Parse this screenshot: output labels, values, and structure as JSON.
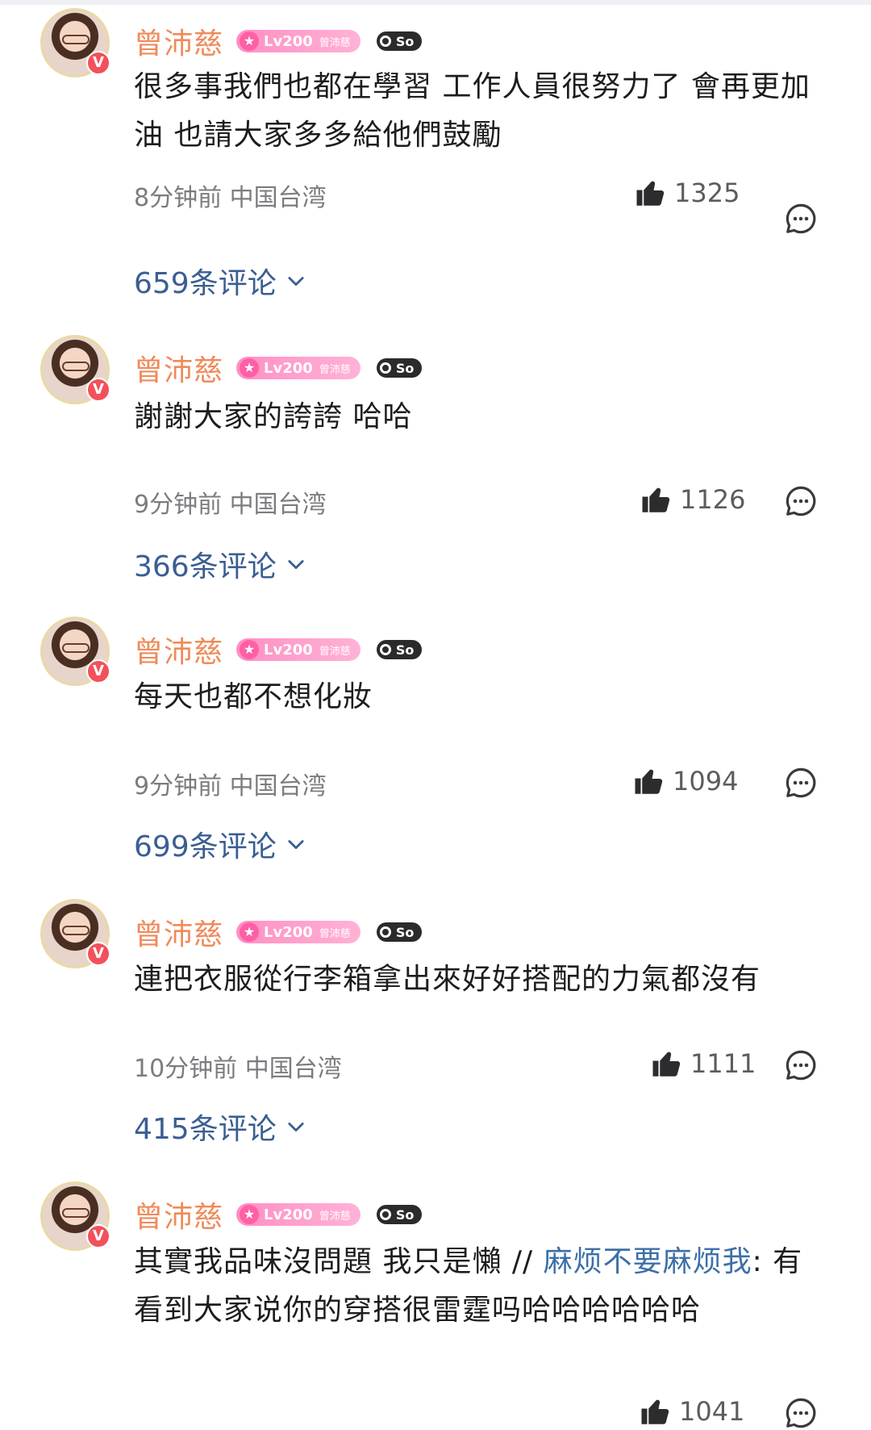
{
  "comments": [
    {
      "username": "曾沛慈",
      "level": "Lv200",
      "level_name": "曾沛慈",
      "so_badge": "So",
      "text": "很多事我們也都在學習 工作人員很努力了 會再更加油 也請大家多多給他們鼓勵",
      "time": "8分钟前",
      "location": "中国台湾",
      "likes": "1325",
      "replies": "659条评论"
    },
    {
      "username": "曾沛慈",
      "level": "Lv200",
      "level_name": "曾沛慈",
      "so_badge": "So",
      "text": "謝謝大家的誇誇 哈哈",
      "time": "9分钟前",
      "location": "中国台湾",
      "likes": "1126",
      "replies": "366条评论"
    },
    {
      "username": "曾沛慈",
      "level": "Lv200",
      "level_name": "曾沛慈",
      "so_badge": "So",
      "text": "每天也都不想化妝",
      "time": "9分钟前",
      "location": "中国台湾",
      "likes": "1094",
      "replies": "699条评论"
    },
    {
      "username": "曾沛慈",
      "level": "Lv200",
      "level_name": "曾沛慈",
      "so_badge": "So",
      "text": "連把衣服從行李箱拿出來好好搭配的力氣都沒有",
      "time": "10分钟前",
      "location": "中国台湾",
      "likes": "1111",
      "replies": "415条评论"
    },
    {
      "username": "曾沛慈",
      "level": "Lv200",
      "level_name": "曾沛慈",
      "so_badge": "So",
      "text": "其實我品味沒問題 我只是懶 // ",
      "mention": "麻烦不要麻烦我",
      "text_after_mention": ": 有看到大家说你的穿搭很雷霆吗哈哈哈哈哈哈",
      "likes": "1041"
    }
  ],
  "icons": {
    "like": "thumbs-up-icon",
    "reply": "comment-bubble-icon",
    "expand": "chevron-down-icon",
    "verified": "verified-v-icon"
  },
  "colors": {
    "username": "#f08a5a",
    "mention": "#3d6fa8",
    "replies_link": "#3a5e92",
    "meta_text": "#7c7c80"
  }
}
